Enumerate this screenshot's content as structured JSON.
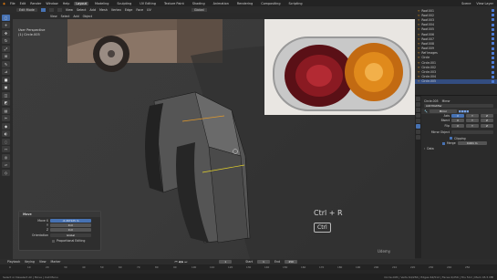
{
  "topbar": {
    "menus": [
      "File",
      "Edit",
      "Render",
      "Window",
      "Help"
    ],
    "workspaces": [
      "Layout",
      "Modeling",
      "Sculpting",
      "UV Editing",
      "Texture Paint",
      "Shading",
      "Animation",
      "Rendering",
      "Compositing",
      "Scripting"
    ],
    "active_workspace": "Layout",
    "scene_label": "Scene",
    "view_layer_label": "View Layer"
  },
  "header": {
    "mode": "Edit Mode",
    "menus": [
      "View",
      "Select",
      "Add",
      "Mesh",
      "Vertex",
      "Edge",
      "Face",
      "UV"
    ],
    "transform": "Global"
  },
  "header2": {
    "items": [
      "View",
      "Select",
      "Add",
      "Object"
    ]
  },
  "viewport": {
    "view_name": "User Perspective",
    "object_name": "(1) Circle.005",
    "shortcut_keys": "Ctrl + R",
    "shortcut_key2": "Ctrl"
  },
  "operator_panel": {
    "title": "Move",
    "move_x_label": "Move X",
    "move_x": "-0.267125 m",
    "y_label": "Y",
    "y": "0 m",
    "z_label": "Z",
    "z": "0 m",
    "orientation_label": "Orientation",
    "orientation": "Global",
    "proportional_label": "Proportional Editing"
  },
  "outliner": {
    "rows": [
      {
        "name": "Roof.001",
        "selected": false
      },
      {
        "name": "Roof.002",
        "selected": false
      },
      {
        "name": "Roof.003",
        "selected": false
      },
      {
        "name": "Roof.004",
        "selected": false
      },
      {
        "name": "Roof.005",
        "selected": false
      },
      {
        "name": "Roof.006",
        "selected": false
      },
      {
        "name": "Roof.007",
        "selected": false
      },
      {
        "name": "Roof.008",
        "selected": false
      },
      {
        "name": "Roof.009",
        "selected": false
      },
      {
        "name": "Ref Images",
        "selected": false
      },
      {
        "name": "Circle",
        "selected": false
      },
      {
        "name": "Circle.001",
        "selected": false
      },
      {
        "name": "Circle.002",
        "selected": false
      },
      {
        "name": "Circle.003",
        "selected": false
      },
      {
        "name": "Circle.004",
        "selected": false
      },
      {
        "name": "Circle.005",
        "selected": true
      }
    ]
  },
  "properties": {
    "object_label": "Circle.005",
    "modifier_type": "Mirror",
    "add_modifier": "Add Modifier",
    "modifier_name": "Mirror",
    "axis_label": "Axis",
    "axis_values": [
      "X",
      "Y",
      "Z"
    ],
    "bisect_label": "Bisect",
    "flip_label": "Flip",
    "mirror_object_label": "Mirror Object",
    "clipping_label": "Clipping",
    "merge_label": "Merge",
    "merge_value": "0.001 m",
    "data_label": "Data"
  },
  "timeline": {
    "menus": [
      "Playback",
      "Keying",
      "View",
      "Marker"
    ],
    "frame_current": "1",
    "start_label": "Start",
    "start": "1",
    "end_label": "End",
    "end": "250",
    "ruler": [
      "0",
      "10",
      "20",
      "30",
      "40",
      "50",
      "60",
      "70",
      "80",
      "90",
      "100",
      "110",
      "120",
      "130",
      "140",
      "150",
      "160",
      "170",
      "180",
      "190",
      "200",
      "210",
      "220",
      "230",
      "240",
      "250"
    ]
  },
  "status": {
    "left": "Select or Deselect All  |  Move  |  Call Menu",
    "right": "Circle.005 | Verts 64/256 | Edges 64/512 | Faces 0/256 | Tris 512 | Mem 45.5 MB"
  },
  "watermark": "Udemy",
  "colors": {
    "accent": "#4772b3",
    "selected_row": "#334d80",
    "viewport_bg": "#3a3a3a",
    "taillight_red": "#8a1a22",
    "taillight_orange": "#e08a1c"
  }
}
